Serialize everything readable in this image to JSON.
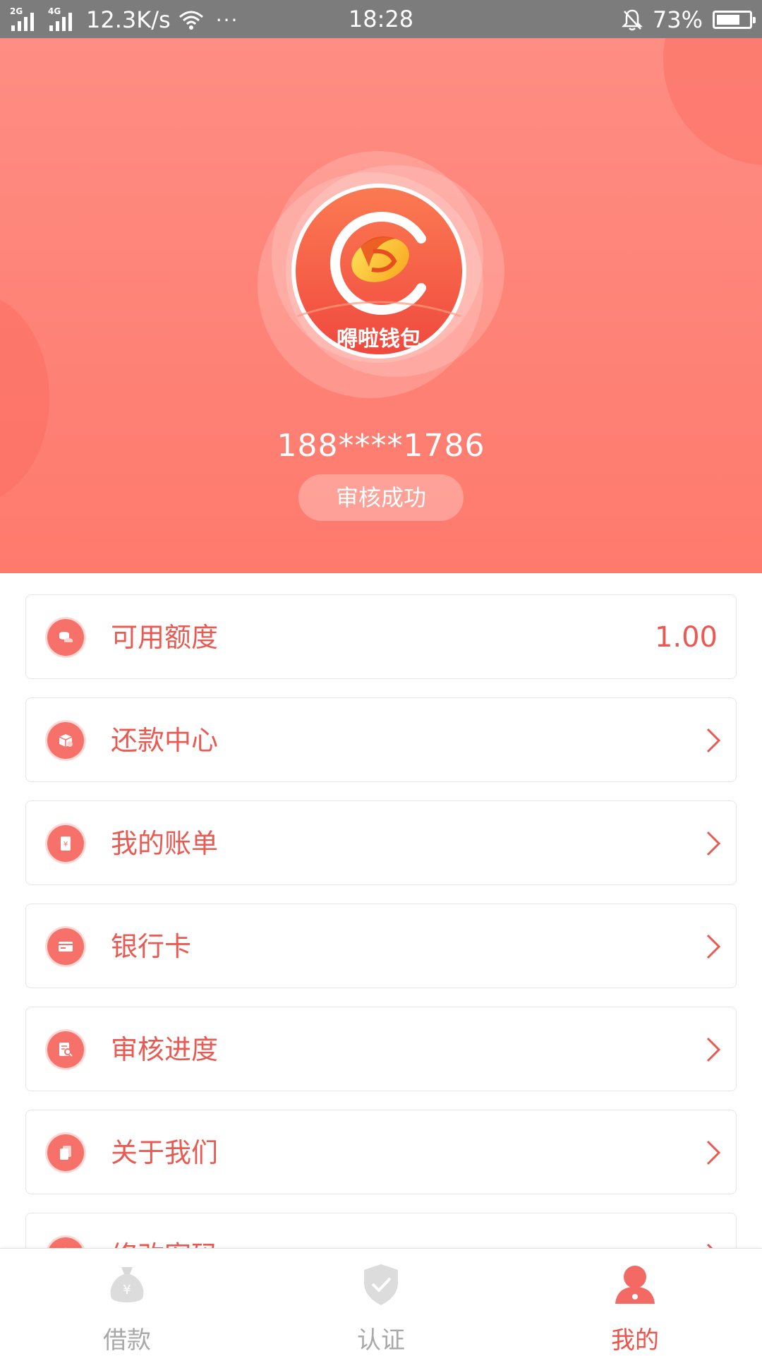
{
  "status_bar": {
    "net_2g": "2G",
    "net_4g": "4G",
    "speed": "12.3K/s",
    "more": "···",
    "time": "18:28",
    "battery_text": "73%",
    "battery_level": 0.73,
    "icons": [
      "signal-icon",
      "wifi-icon",
      "bell-off-icon",
      "battery-icon"
    ]
  },
  "profile": {
    "logo_text": "嘚啦钱包",
    "phone": "188****1786",
    "status": "审核成功"
  },
  "menu": {
    "items": [
      {
        "label": "可用额度",
        "value": "1.00",
        "icon": "coins-icon"
      },
      {
        "label": "还款中心",
        "icon": "box-icon"
      },
      {
        "label": "我的账单",
        "icon": "bill-icon"
      },
      {
        "label": "银行卡",
        "icon": "card-icon"
      },
      {
        "label": "审核进度",
        "icon": "search-doc-icon"
      },
      {
        "label": "关于我们",
        "icon": "copy-icon"
      },
      {
        "label": "修改密码",
        "icon": "lock-icon"
      }
    ]
  },
  "bottom_nav": {
    "tabs": [
      {
        "label": "借款",
        "icon": "money-bag-icon",
        "active": false
      },
      {
        "label": "认证",
        "icon": "shield-icon",
        "active": false
      },
      {
        "label": "我的",
        "icon": "person-icon",
        "active": true
      }
    ]
  },
  "colors": {
    "header_top": "#fe8d83",
    "header_bottom": "#fe7a6d",
    "accent": "#e85a52",
    "icon_bg": "#f6716a",
    "tab_inactive": "#a8a8a8",
    "tab_active": "#f0524a"
  }
}
